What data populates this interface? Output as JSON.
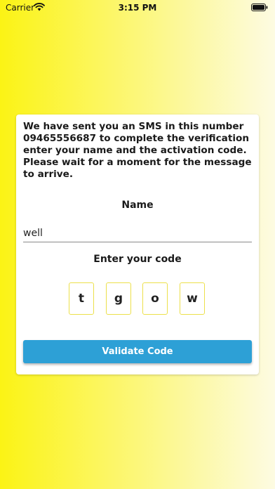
{
  "status_bar": {
    "carrier": "Carrier",
    "time": "3:15 PM",
    "wifi_icon": "wifi-icon",
    "battery_icon": "battery-icon"
  },
  "verification": {
    "message": "We have sent you an SMS in this number 09465556687 to complete the verification enter your name and the activation code. Please wait for a moment for the message to arrive.",
    "name_label": "Name",
    "name_value": "well",
    "code_label": "Enter your code",
    "code_digits": [
      "t",
      "g",
      "o",
      "w"
    ],
    "validate_label": "Validate Code"
  },
  "colors": {
    "background_start": "#fbf315",
    "background_end": "#fdfbe2",
    "button": "#2da0d6",
    "code_border": "#ece04a"
  }
}
